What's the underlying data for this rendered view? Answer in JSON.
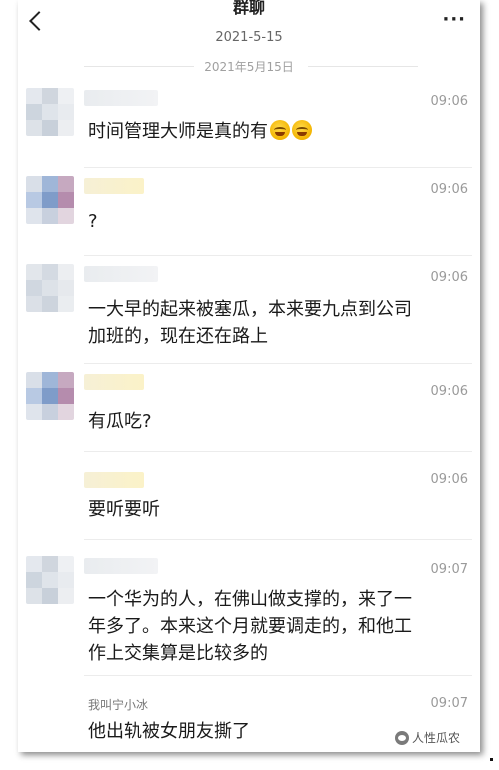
{
  "header": {
    "title": "群聊",
    "subtitle": "2021-5-15",
    "more_label": "···"
  },
  "date_separator": "2021年5月15日",
  "messages": [
    {
      "name": "",
      "time": "09:06",
      "text": "时间管理大师是真的有",
      "emoji": [
        "laughing-crying-emoji",
        "laughing-crying-emoji"
      ]
    },
    {
      "name": "",
      "time": "09:06",
      "text": "?"
    },
    {
      "name": "",
      "time": "09:06",
      "text": "一大早的起来被塞瓜，本来要九点到公司\n加班的，现在还在路上"
    },
    {
      "name": "",
      "time": "09:06",
      "text": "有瓜吃?"
    },
    {
      "name": "",
      "time": "09:06",
      "text": "要听要听"
    },
    {
      "name": "",
      "time": "09:07",
      "text": "一个华为的人，在佛山做支撑的，来了一\n年多了。本来这个月就要调走的，和他工\n作上交集算是比较多的"
    },
    {
      "name": "我叫宁小冰",
      "time": "09:07",
      "text": "他出轨被女朋友撕了"
    }
  ],
  "watermark": "人性瓜农",
  "colors": {
    "background": "#ffffff",
    "text": "#1a1a1a",
    "muted": "#9a9a9a",
    "name_blur_yellow": "#fbf2c8"
  }
}
